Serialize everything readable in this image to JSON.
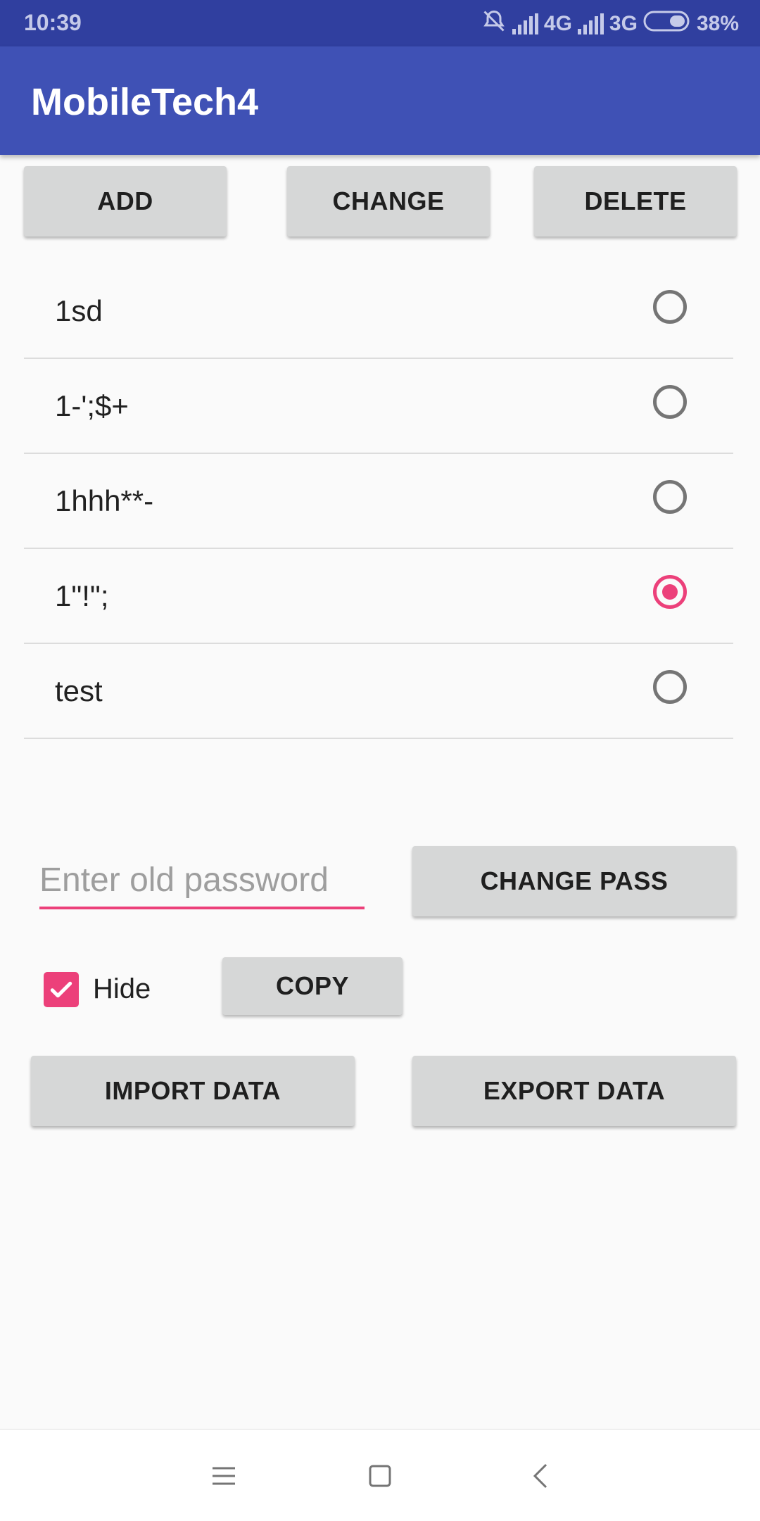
{
  "status_bar": {
    "time": "10:39",
    "network_1": "4G",
    "network_2": "3G",
    "battery": "38%"
  },
  "app_bar": {
    "title": "MobileTech4"
  },
  "toolbar": {
    "add_label": "ADD",
    "change_label": "CHANGE",
    "delete_label": "DELETE"
  },
  "list": {
    "items": [
      {
        "label": "1sd",
        "selected": false
      },
      {
        "label": "1-';$+",
        "selected": false
      },
      {
        "label": "1hhh**-",
        "selected": false
      },
      {
        "label": "1\"!\";",
        "selected": true
      },
      {
        "label": "test",
        "selected": false
      }
    ]
  },
  "password": {
    "placeholder": "Enter old password",
    "value": "",
    "change_pass_label": "CHANGE PASS"
  },
  "options": {
    "hide_label": "Hide",
    "hide_checked": true,
    "copy_label": "COPY"
  },
  "data_actions": {
    "import_label": "IMPORT DATA",
    "export_label": "EXPORT DATA"
  },
  "colors": {
    "primary": "#3f51b5",
    "primary_dark": "#303f9f",
    "accent": "#ec407a",
    "button_bg": "#d6d7d7"
  },
  "nav_bar": {
    "icons": [
      "menu-icon",
      "home-square-icon",
      "back-chevron-icon"
    ]
  }
}
